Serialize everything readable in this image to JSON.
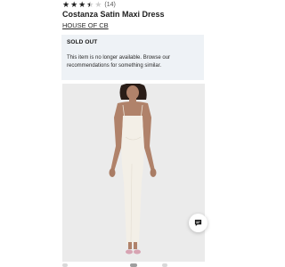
{
  "product": {
    "rating": 3.5,
    "rating_max": 5,
    "review_count": "(14)",
    "title": "Costanza Satin Maxi Dress",
    "brand": "HOUSE OF CB"
  },
  "notice": {
    "title": "SOLD OUT",
    "message": "This item is no longer available. Browse our recommendations for something similar."
  },
  "image": {
    "background": "#ebebeb",
    "dress_color": "#f3efe7"
  },
  "icons": {
    "chat": "chat-bubble-icon",
    "star": "star-icon"
  },
  "colors": {
    "notice_bg": "#eef2f6",
    "text": "#1a1a1a"
  }
}
